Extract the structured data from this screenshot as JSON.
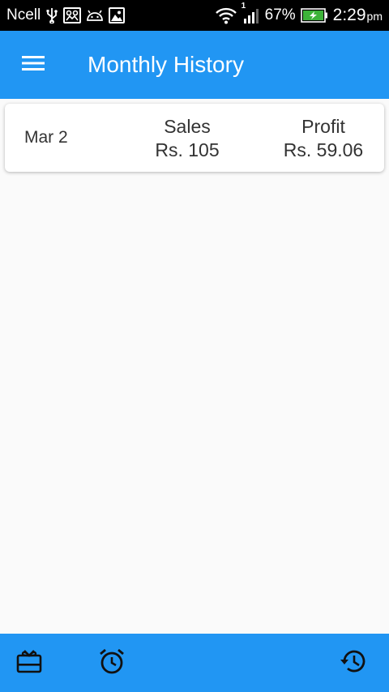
{
  "status_bar": {
    "carrier": "Ncell",
    "battery_percent": "67%",
    "time": "2:29",
    "time_suffix": "pm",
    "signal_slot": "1",
    "icons": [
      "usb-icon",
      "photo-icon",
      "android-icon",
      "image-icon",
      "wifi-icon",
      "signal-icon",
      "battery-charging-icon"
    ]
  },
  "app_bar": {
    "title": "Monthly History",
    "menu_icon": "menu-icon"
  },
  "history": {
    "items": [
      {
        "date": "Mar 2",
        "sales_label": "Sales",
        "sales_value": "Rs. 105",
        "profit_label": "Profit",
        "profit_value": "Rs. 59.06"
      }
    ]
  },
  "bottom_nav": {
    "items": [
      {
        "icon": "card-giftcard-icon"
      },
      {
        "icon": "alarm-icon"
      },
      {
        "icon": "history-icon"
      }
    ]
  },
  "colors": {
    "primary": "#2196f3",
    "background": "#fafafa",
    "status_bar": "#000000",
    "battery": "#3db339"
  }
}
